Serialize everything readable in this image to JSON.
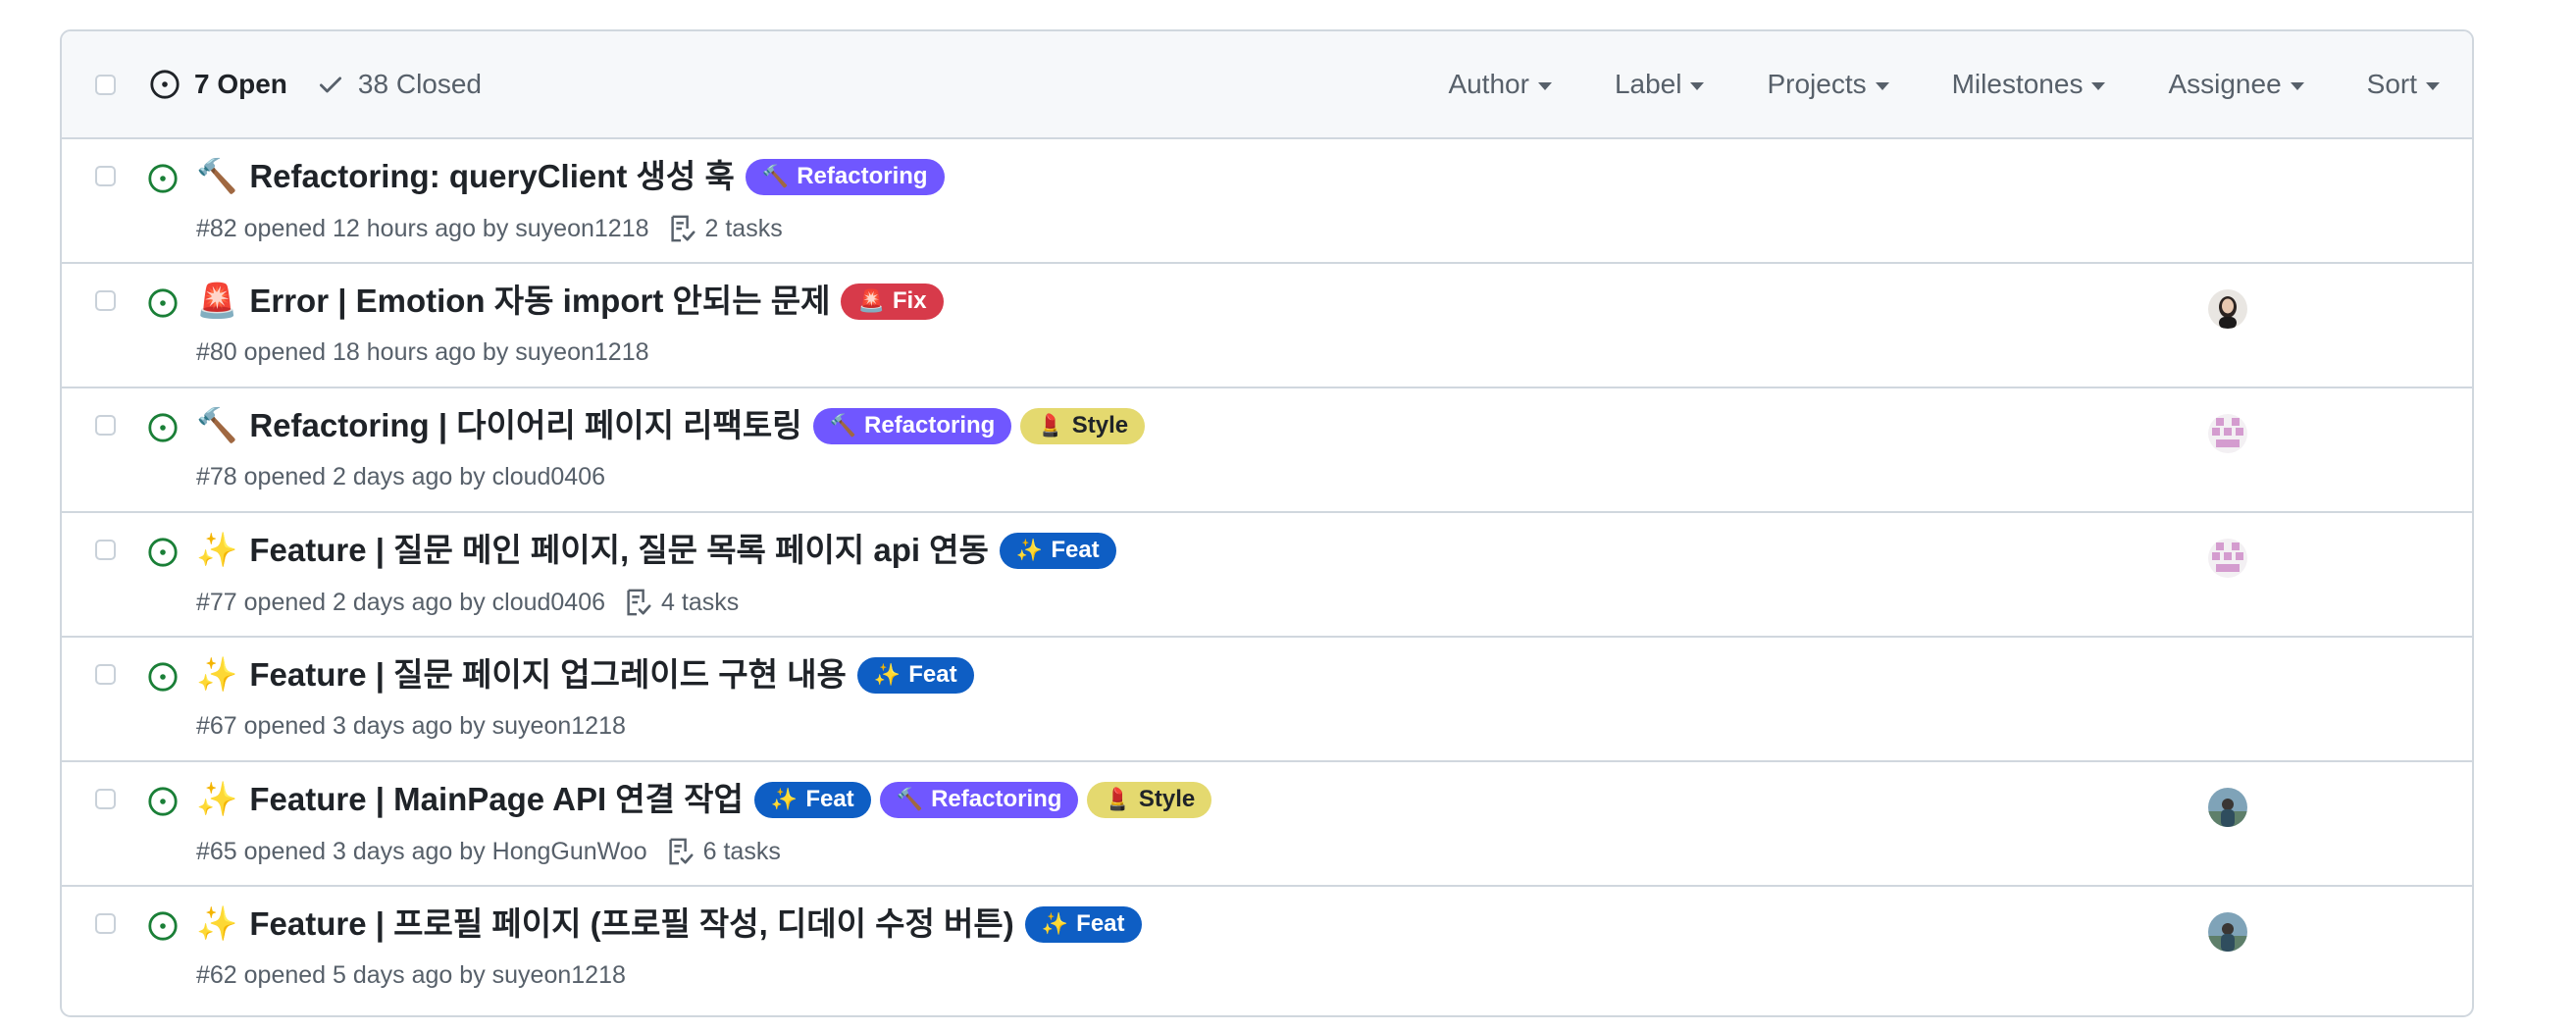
{
  "header": {
    "open_label": "7 Open",
    "closed_label": "38 Closed",
    "filters": [
      {
        "label": "Author"
      },
      {
        "label": "Label"
      },
      {
        "label": "Projects"
      },
      {
        "label": "Milestones"
      },
      {
        "label": "Assignee"
      },
      {
        "label": "Sort"
      }
    ]
  },
  "colors": {
    "open_icon": "#1a7f37",
    "label_refactoring": "#7057ff",
    "label_fix": "#d73a4a",
    "label_style": "#e4d96f",
    "label_feat": "#0e5ec4"
  },
  "issues": [
    {
      "emoji": "🔨",
      "title": "Refactoring: queryClient 생성 훅",
      "labels": [
        {
          "emoji": "🔨",
          "text": "Refactoring",
          "kind": "refactoring"
        }
      ],
      "meta": "#82 opened 12 hours ago by ",
      "author": "suyeon1218",
      "tasks": "2 tasks",
      "assignee": null
    },
    {
      "emoji": "🚨",
      "title": "Error | Emotion 자동 import 안되는 문제",
      "labels": [
        {
          "emoji": "🚨",
          "text": "Fix",
          "kind": "fix"
        }
      ],
      "meta": "#80 opened 18 hours ago by ",
      "author": "suyeon1218",
      "tasks": null,
      "assignee": "photo-woman"
    },
    {
      "emoji": "🔨",
      "title": "Refactoring | 다이어리 페이지 리팩토링",
      "labels": [
        {
          "emoji": "🔨",
          "text": "Refactoring",
          "kind": "refactoring"
        },
        {
          "emoji": "💄",
          "text": "Style",
          "kind": "style"
        }
      ],
      "meta": "#78 opened 2 days ago by ",
      "author": "cloud0406",
      "tasks": null,
      "assignee": "identicon-pink"
    },
    {
      "emoji": "✨",
      "title": "Feature | 질문 메인 페이지, 질문 목록 페이지 api 연동",
      "labels": [
        {
          "emoji": "✨",
          "text": "Feat",
          "kind": "feat"
        }
      ],
      "meta": "#77 opened 2 days ago by ",
      "author": "cloud0406",
      "tasks": "4 tasks",
      "assignee": "identicon-pink"
    },
    {
      "emoji": "✨",
      "title": "Feature | 질문 페이지 업그레이드 구현 내용",
      "labels": [
        {
          "emoji": "✨",
          "text": "Feat",
          "kind": "feat"
        }
      ],
      "meta": "#67 opened 3 days ago by ",
      "author": "suyeon1218",
      "tasks": null,
      "assignee": null
    },
    {
      "emoji": "✨",
      "title": "Feature | MainPage API 연결 작업",
      "labels": [
        {
          "emoji": "✨",
          "text": "Feat",
          "kind": "feat"
        },
        {
          "emoji": "🔨",
          "text": "Refactoring",
          "kind": "refactoring"
        },
        {
          "emoji": "💄",
          "text": "Style",
          "kind": "style"
        }
      ],
      "meta": "#65 opened 3 days ago by ",
      "author": "HongGunWoo",
      "tasks": "6 tasks",
      "assignee": "photo-landscape"
    },
    {
      "emoji": "✨",
      "title": "Feature | 프로필 페이지 (프로필 작성, 디데이 수정 버튼)",
      "labels": [
        {
          "emoji": "✨",
          "text": "Feat",
          "kind": "feat"
        }
      ],
      "meta": "#62 opened 5 days ago by ",
      "author": "suyeon1218",
      "tasks": null,
      "assignee": "photo-landscape"
    }
  ]
}
